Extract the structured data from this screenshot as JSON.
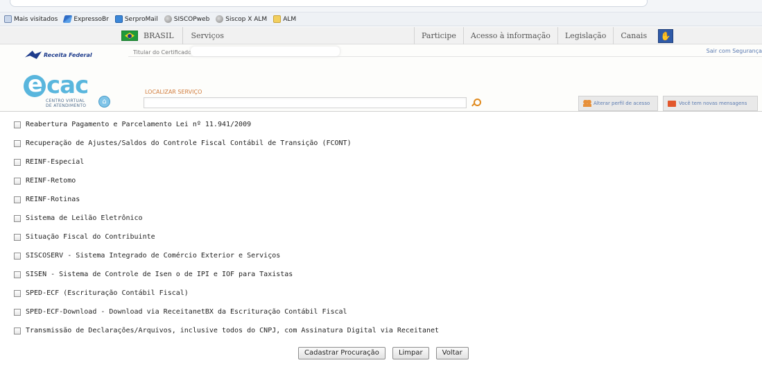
{
  "bookmarks": [
    {
      "label": "Mais visitados",
      "icon": "page-icon"
    },
    {
      "label": "ExpressoBr",
      "icon": "expresso-icon"
    },
    {
      "label": "SerproMail",
      "icon": "serpro-icon"
    },
    {
      "label": "SISCOPweb",
      "icon": "globe-icon"
    },
    {
      "label": "Siscop X ALM",
      "icon": "globe-icon"
    },
    {
      "label": "ALM",
      "icon": "folder-icon"
    }
  ],
  "govbar": {
    "brasil": "BRASIL",
    "servicos": "Serviços",
    "links": [
      "Participe",
      "Acesso à informação",
      "Legislação",
      "Canais"
    ]
  },
  "header": {
    "receita": "Receita Federal",
    "titular": "Titular do Certificado:",
    "sair": "Sair com Segurança",
    "ecac_line1": "CENTRO VIRTUAL",
    "ecac_line2": "DE ATENDIMENTO",
    "localizar": "LOCALIZAR SERVIÇO",
    "perfil": "Alterar perfil de acesso",
    "mensagens": "Você tem novas mensagens"
  },
  "services": [
    "Reabertura Pagamento e Parcelamento Lei nº 11.941/2009",
    "Recuperação de Ajustes/Saldos do Controle Fiscal Contábil de Transição (FCONT)",
    "REINF-Especial",
    "REINF-Retomo",
    "REINF-Rotinas",
    "Sistema de Leilão Eletrônico",
    "Situação Fiscal do Contribuinte",
    "SISCOSERV - Sistema Integrado de Comércio Exterior e Serviços",
    "SISEN - Sistema de Controle de Isen o de IPI e IOF para Taxistas",
    "SPED-ECF (Escrituração Contábil Fiscal)",
    "SPED-ECF-Download - Download via ReceitanetBX da Escrituração Contábil Fiscal",
    "Transmissão de Declarações/Arquivos, inclusive todos do CNPJ, com Assinatura Digital via Receitanet"
  ],
  "buttons": {
    "cadastrar": "Cadastrar Procuração",
    "limpar": "Limpar",
    "voltar": "Voltar"
  }
}
